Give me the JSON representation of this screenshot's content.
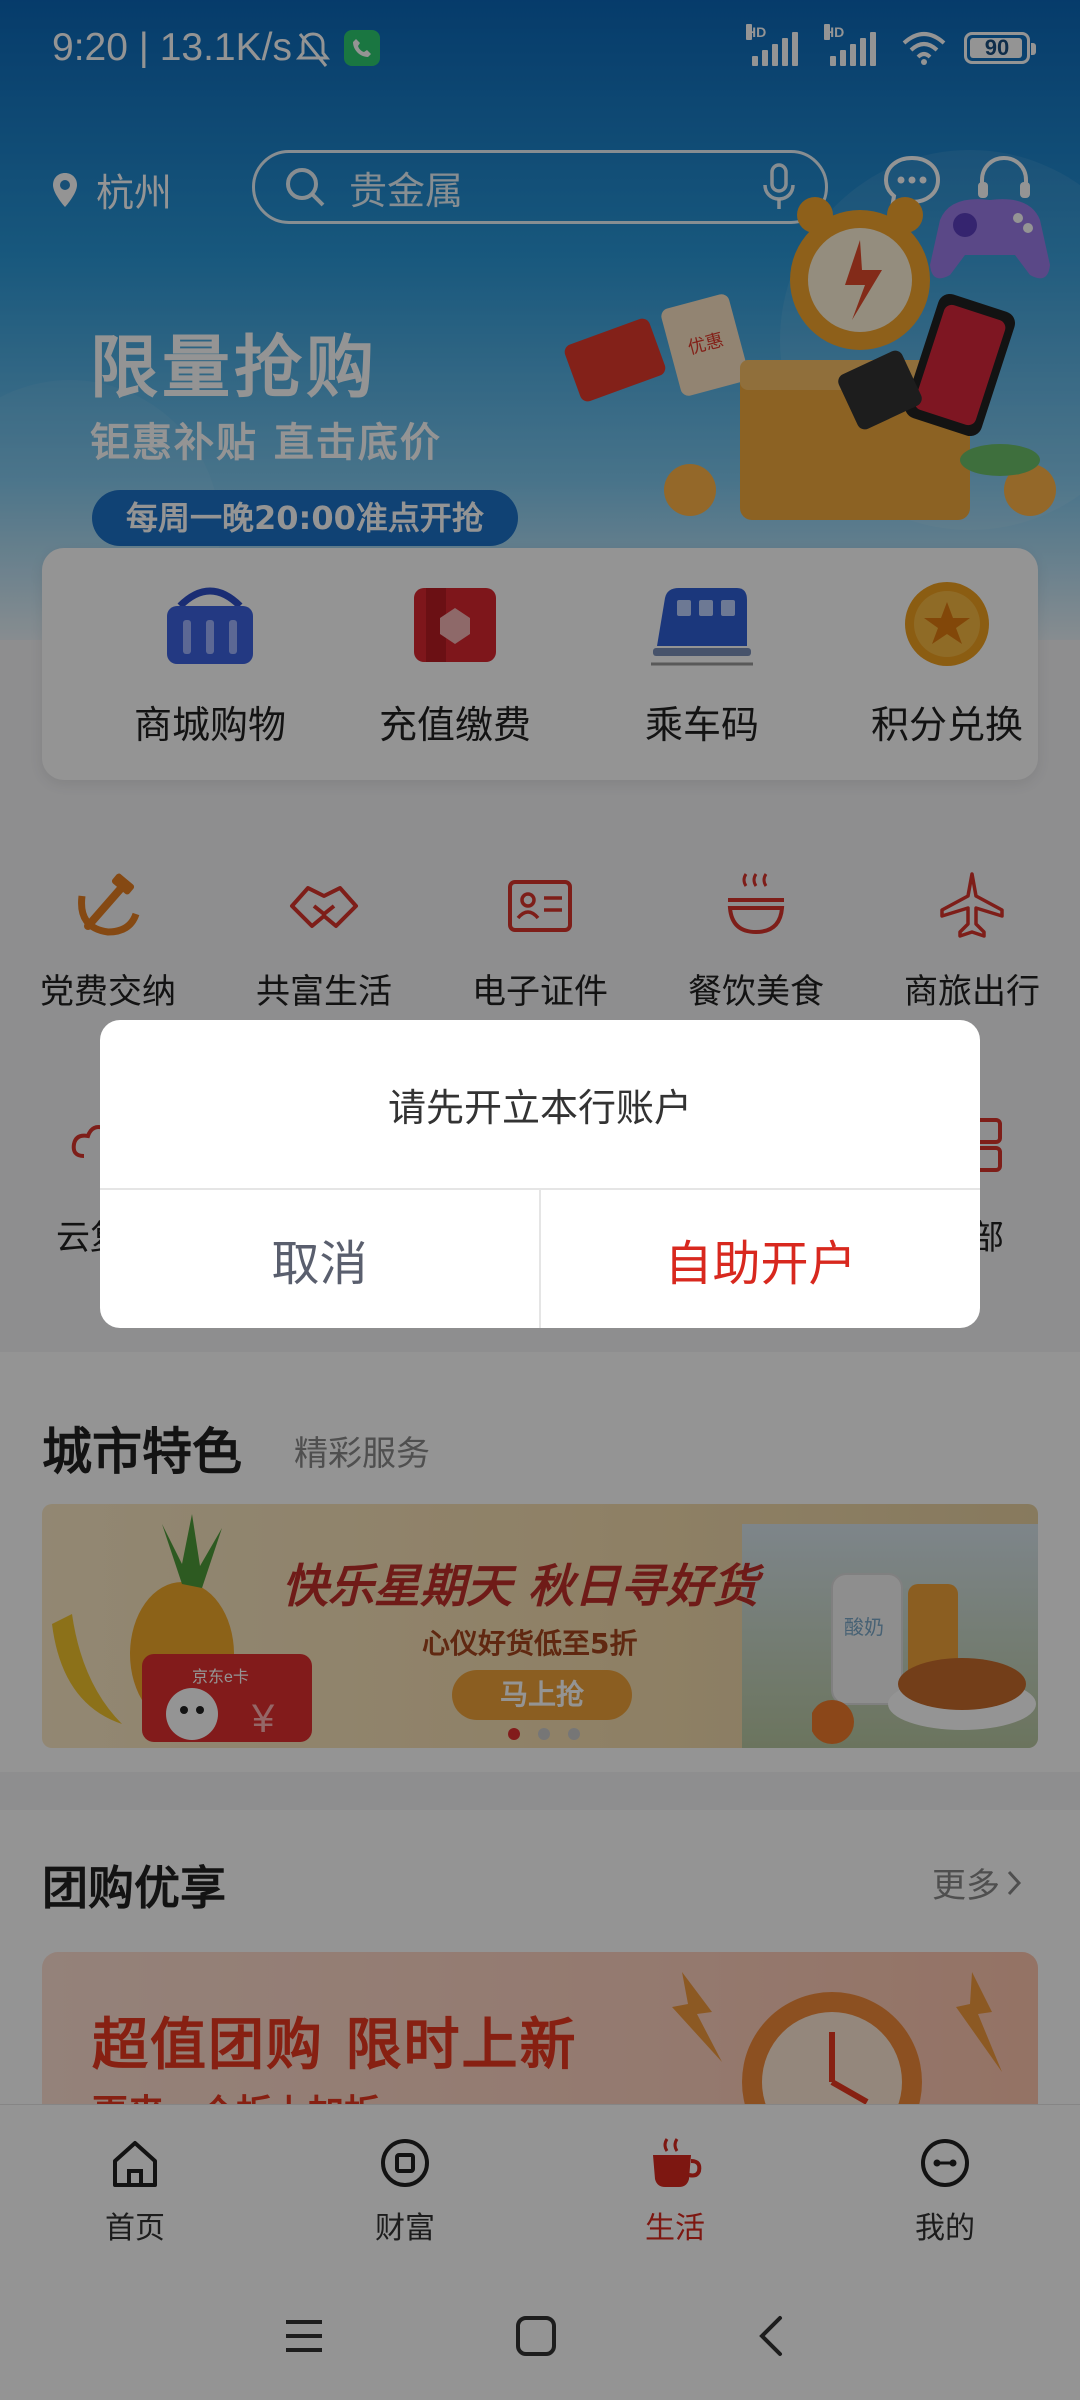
{
  "status_bar": {
    "time": "9:20 | 13.1K/s",
    "hd1": "HD",
    "hd2": "HD",
    "battery": "90"
  },
  "header": {
    "city": "杭州",
    "search_placeholder": "贵金属"
  },
  "promo": {
    "title": "限量抢购",
    "subtitle": "钜惠补贴 直击底价",
    "pill": "每周一晚20:00准点开抢",
    "ticket_text": "优惠"
  },
  "quick_actions": [
    {
      "label": "商城购物",
      "icon": "shopping-basket-icon"
    },
    {
      "label": "充值缴费",
      "icon": "recharge-wallet-icon"
    },
    {
      "label": "乘车码",
      "icon": "train-icon"
    },
    {
      "label": "积分兑换",
      "icon": "star-coin-icon"
    }
  ],
  "services_row1": [
    {
      "label": "党费交纳",
      "icon": "party-emblem-icon"
    },
    {
      "label": "共富生活",
      "icon": "handshake-icon"
    },
    {
      "label": "电子证件",
      "icon": "id-card-icon"
    },
    {
      "label": "餐饮美食",
      "icon": "food-bowl-icon"
    },
    {
      "label": "商旅出行",
      "icon": "airplane-icon"
    }
  ],
  "services_row2_partial": {
    "left_label": "云复",
    "right_label": "部"
  },
  "city_section": {
    "title": "城市特色",
    "subtitle": "精彩服务",
    "banner_headline": "快乐星期天 秋日寻好货",
    "banner_sub": "心仪好货低至5折",
    "banner_button": "马上抢",
    "card_label": "京东e卡",
    "yen": "¥",
    "bottle_label": "酸奶"
  },
  "group_section": {
    "title": "团购优享",
    "more": "更多",
    "banner_headline": "超值团购 限时上新",
    "banner_sub": "更来一个折上加折"
  },
  "bottom_nav": [
    {
      "label": "首页",
      "icon": "home-icon",
      "active": false
    },
    {
      "label": "财富",
      "icon": "wealth-icon",
      "active": false
    },
    {
      "label": "生活",
      "icon": "coffee-cup-icon",
      "active": true
    },
    {
      "label": "我的",
      "icon": "profile-icon",
      "active": false
    }
  ],
  "dialog": {
    "message": "请先开立本行账户",
    "cancel": "取消",
    "confirm": "自助开户"
  },
  "colors": {
    "accent_red": "#d8281e",
    "header_blue": "#0b67b8",
    "cancel_gray": "#5a5f6e"
  }
}
